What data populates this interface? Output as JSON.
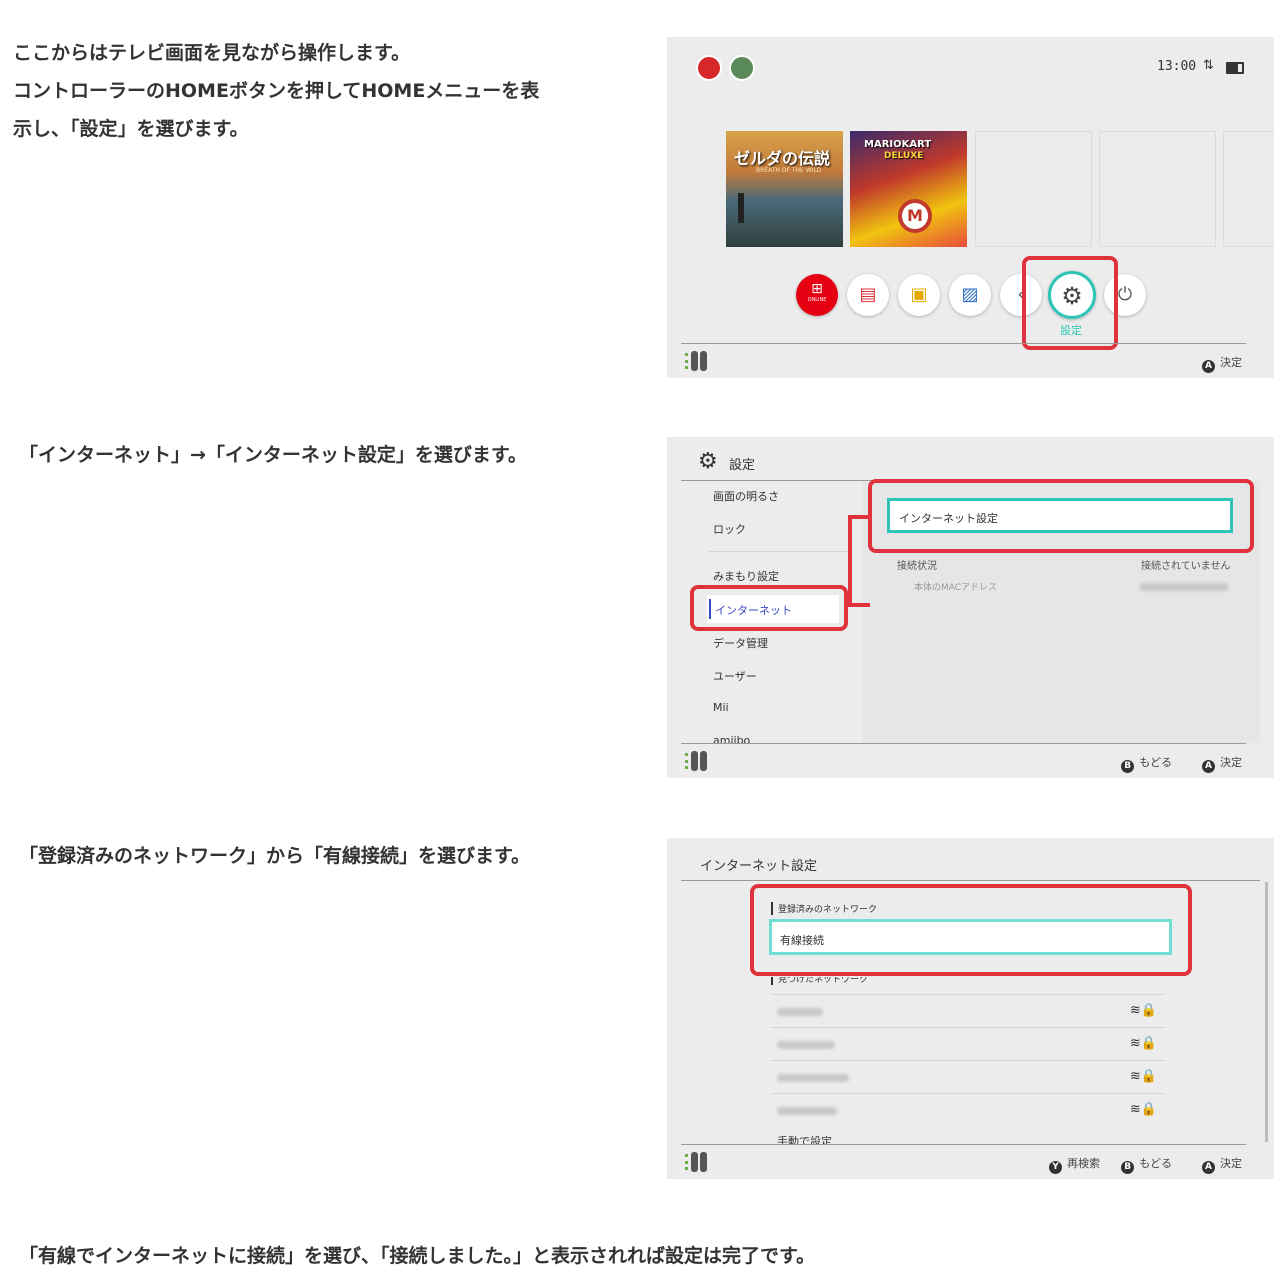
{
  "step1": {
    "lines": [
      "ここからはテレビ画面を見ながら操作します。",
      "コントローラーのHOMEボタンを押してHOMEメニューを表",
      "示し、「設定」を選びます。"
    ]
  },
  "home": {
    "time": "13:00",
    "games": [
      {
        "title": "ゼルダの伝説",
        "subtitle": "BREATH OF THE WILD"
      },
      {
        "title": "MARIOKART",
        "subtitle": "DELUXE"
      }
    ],
    "online_label": "ONLINE",
    "settings_label": "設定",
    "footer_confirm": "決定",
    "button_a": "A"
  },
  "step2": {
    "text": "「インターネット」→「インターネット設定」を選びます。"
  },
  "settings": {
    "title": "設定",
    "sidebar": [
      "画面の明るさ",
      "ロック",
      "みまもり設定",
      "インターネット",
      "データ管理",
      "ユーザー",
      "Mii",
      "amiibo"
    ],
    "internet_settings_button": "インターネット設定",
    "status_label": "接続状況",
    "status_value": "接続されていません",
    "mac_label": "本体のMACアドレス",
    "footer_back": "もどる",
    "footer_confirm": "決定",
    "button_b": "B",
    "button_a": "A"
  },
  "step3": {
    "text": "「登録済みのネットワーク」から「有線接続」を選びます。"
  },
  "internet": {
    "title": "インターネット設定",
    "registered_header": "登録済みのネットワーク",
    "wired_item": "有線接続",
    "found_header": "見つけたネットワーク",
    "manual": "手動で設定",
    "footer_research": "再検索",
    "footer_back": "もどる",
    "footer_confirm": "決定",
    "button_y": "Y",
    "button_b": "B",
    "button_a": "A"
  },
  "step4": {
    "text": "「有線でインターネットに接続」を選び、「接続しました。」と表示されれば設定は完了です。"
  },
  "colors": {
    "highlight": "#e0323c",
    "teal": "#2ec4b6",
    "online_red": "#e60012"
  }
}
